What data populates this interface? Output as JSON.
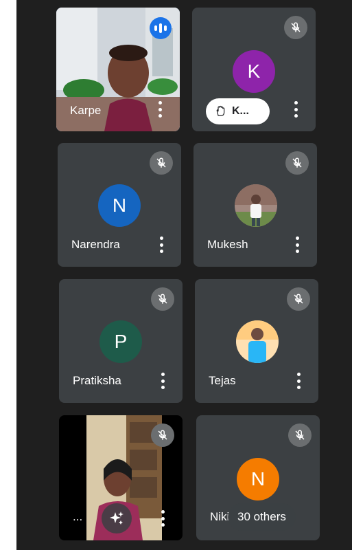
{
  "tiles": [
    {
      "name": "Karpe",
      "status": "speaking",
      "view": "camera"
    },
    {
      "name": "K...",
      "avatar_letter": "K",
      "avatar_color": "#8e24aa",
      "status": "muted",
      "hand_raised": true
    },
    {
      "name": "Narendra",
      "avatar_letter": "N",
      "avatar_color": "#1565c0",
      "status": "muted"
    },
    {
      "name": "Mukesh",
      "status": "muted",
      "view": "profile-photo"
    },
    {
      "name": "Pratiksha",
      "avatar_letter": "P",
      "avatar_color": "#1e5b4a",
      "status": "muted"
    },
    {
      "name": "Tejas",
      "status": "muted",
      "view": "profile-photo"
    },
    {
      "name": "...",
      "status": "muted",
      "view": "camera",
      "effects_icon": "sparkle-icon"
    },
    {
      "name": "Niki",
      "avatar_letter": "N",
      "avatar_color": "#f57c00",
      "status": "muted",
      "overflow_label": "30 others"
    }
  ],
  "icons": {
    "mic_off": "mic-off-icon",
    "more": "more-vert-icon",
    "hand": "raise-hand-icon",
    "speaking": "speaking-indicator-icon"
  }
}
